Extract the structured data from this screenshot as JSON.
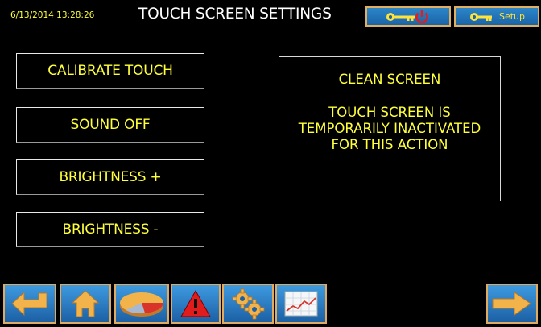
{
  "header": {
    "timestamp": "6/13/2014 13:28:26",
    "title": "TOUCH SCREEN SETTINGS",
    "logout_icon": "key-power-icon",
    "setup_label": "Setup",
    "setup_icon": "key-icon"
  },
  "buttons": {
    "calibrate": "CALIBRATE TOUCH",
    "sound": "SOUND OFF",
    "brightness_up": "BRIGHTNESS +",
    "brightness_down": "BRIGHTNESS -"
  },
  "info_panel": {
    "title": "CLEAN SCREEN",
    "message": "TOUCH SCREEN IS TEMPORARILY INACTIVATED FOR THIS ACTION"
  },
  "nav": {
    "items": [
      {
        "name": "back",
        "icon": "arrow-left-icon"
      },
      {
        "name": "home",
        "icon": "home-icon"
      },
      {
        "name": "overview",
        "icon": "pie-chart-icon"
      },
      {
        "name": "alarms",
        "icon": "warning-icon"
      },
      {
        "name": "settings",
        "icon": "gears-icon"
      },
      {
        "name": "trend",
        "icon": "trend-chart-icon"
      },
      {
        "name": "next",
        "icon": "arrow-right-icon"
      }
    ]
  },
  "colors": {
    "background": "#000000",
    "text_yellow": "#ffff3c",
    "button_blue": "#2c86c8",
    "nav_border": "#e0aa60",
    "arrow_orange": "#f2b44a"
  }
}
